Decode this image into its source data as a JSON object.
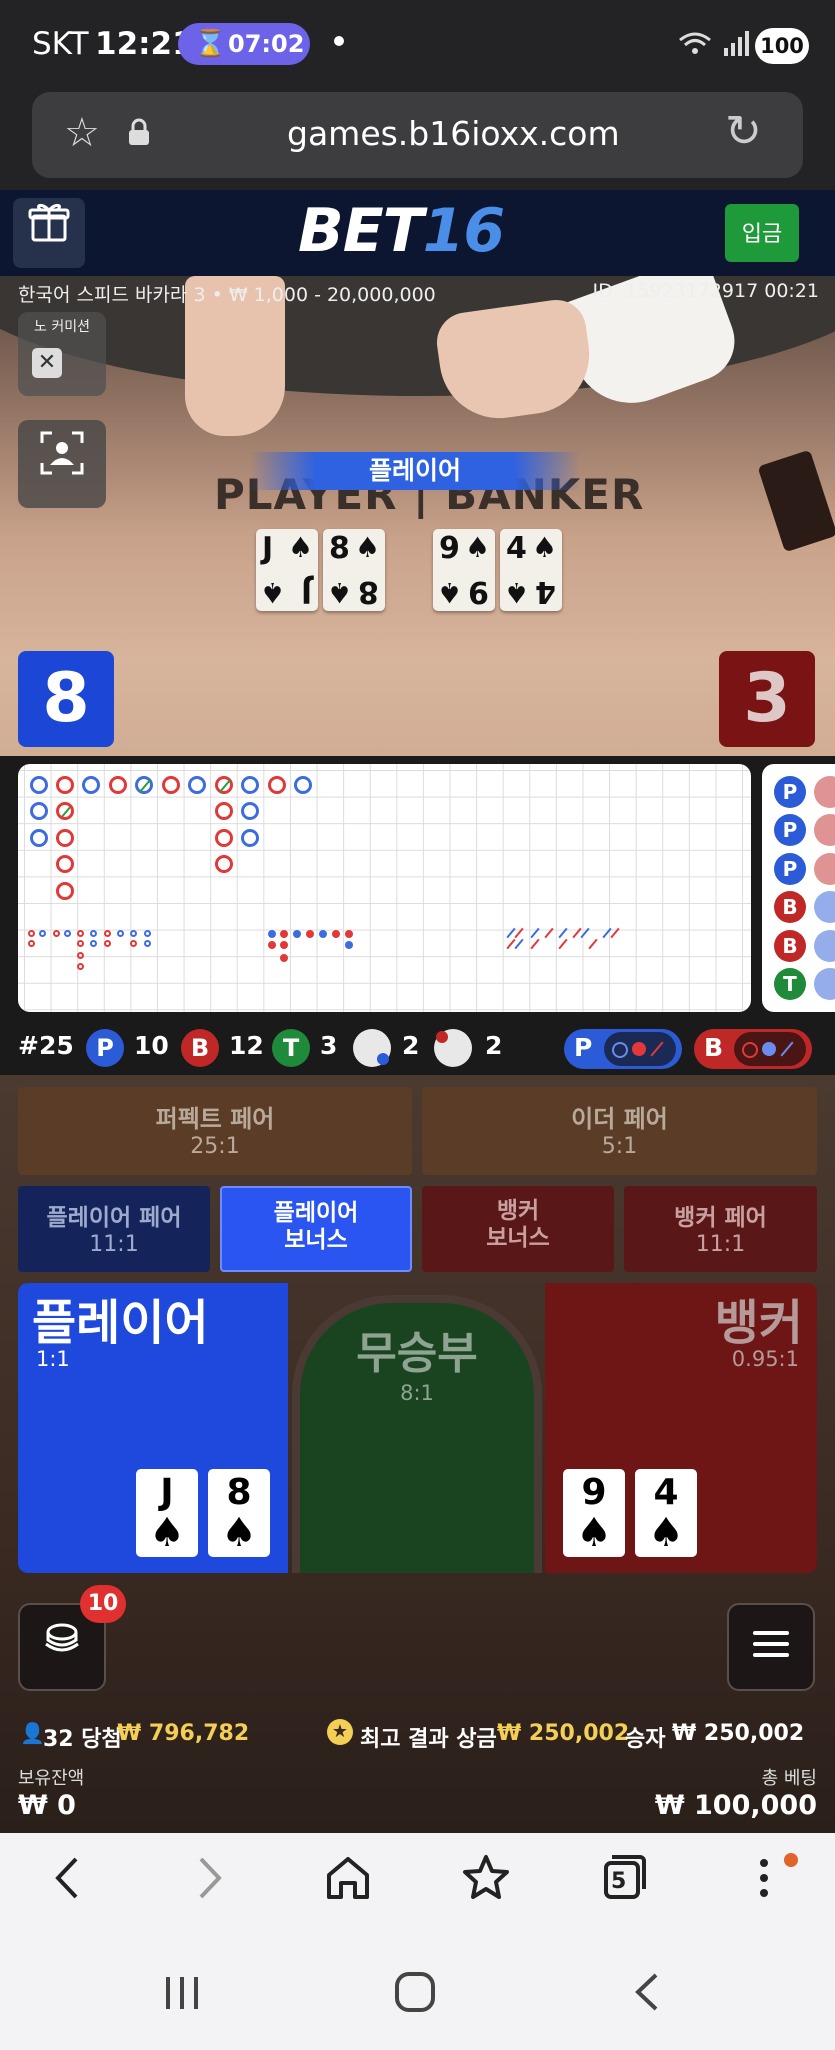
{
  "status_bar": {
    "carrier": "SKT",
    "time": "12:21",
    "timer": "07:02",
    "battery": "100"
  },
  "browser": {
    "url": "games.b16ioxx.com",
    "tabs_count": "5"
  },
  "header": {
    "logo_main": "BET",
    "logo_num": "16",
    "deposit_label": "입금"
  },
  "video": {
    "table_info": "한국어 스피드 바카라 3 • ₩ 1,000 - 20,000,000",
    "round_id": "ID: 15923172917 00:21",
    "no_commission_label": "노 커미션",
    "winner_banner": "플레이어",
    "table_player": "PLAYER",
    "table_banker": "BANKER",
    "player_cards": [
      {
        "rank": "J",
        "suit": "♠"
      },
      {
        "rank": "8",
        "suit": "♠"
      }
    ],
    "banker_cards": [
      {
        "rank": "9",
        "suit": "♠"
      },
      {
        "rank": "4",
        "suit": "♠"
      }
    ]
  },
  "scores": {
    "player": "8",
    "banker": "3"
  },
  "stats": {
    "round": "#25",
    "player_label": "P",
    "player_count": "10",
    "banker_label": "B",
    "banker_count": "12",
    "tie_label": "T",
    "tie_count": "3",
    "player_pair_count": "2",
    "banker_pair_count": "2",
    "ask_player": "P",
    "ask_banker": "B"
  },
  "side_bets": {
    "perfect_pair": {
      "name": "퍼펙트 페어",
      "odds": "25:1"
    },
    "either_pair": {
      "name": "이더 페어",
      "odds": "5:1"
    },
    "player_pair": {
      "name": "플레이어 페어",
      "odds": "11:1"
    },
    "player_bonus": {
      "line1": "플레이어",
      "line2": "보너스"
    },
    "banker_bonus": {
      "line1": "뱅커",
      "line2": "보너스"
    },
    "banker_pair": {
      "name": "뱅커 페어",
      "odds": "11:1"
    }
  },
  "main_bets": {
    "player": {
      "name": "플레이어",
      "odds": "1:1"
    },
    "tie": {
      "name": "무승부",
      "odds": "8:1"
    },
    "banker": {
      "name": "뱅커",
      "odds": "0.95:1"
    }
  },
  "bottom": {
    "chip_badge": "10",
    "winners": "32 당첨",
    "winners_amount": "₩ 796,782",
    "top_result_label": "최고 결과 상금",
    "top_result_amount": "₩ 250,002",
    "winner_label": "승자",
    "winner_amount": "₩ 250,002",
    "balance_label": "보유잔액",
    "balance_value": "₩ 0",
    "total_bet_label": "총 베팅",
    "total_bet_value": "₩ 100,000"
  },
  "colors": {
    "player": "#1f49dd",
    "banker": "#6e1616",
    "tie": "#1a4420",
    "deposit": "#1f9a3a"
  },
  "icons": [
    "star-icon",
    "lock-icon",
    "reload-icon",
    "gift-icon",
    "close-icon",
    "camera-icon",
    "chip-icon",
    "menu-icon",
    "back-icon",
    "forward-icon",
    "home-icon",
    "bookmarks-icon",
    "tabs-icon",
    "more-icon"
  ]
}
